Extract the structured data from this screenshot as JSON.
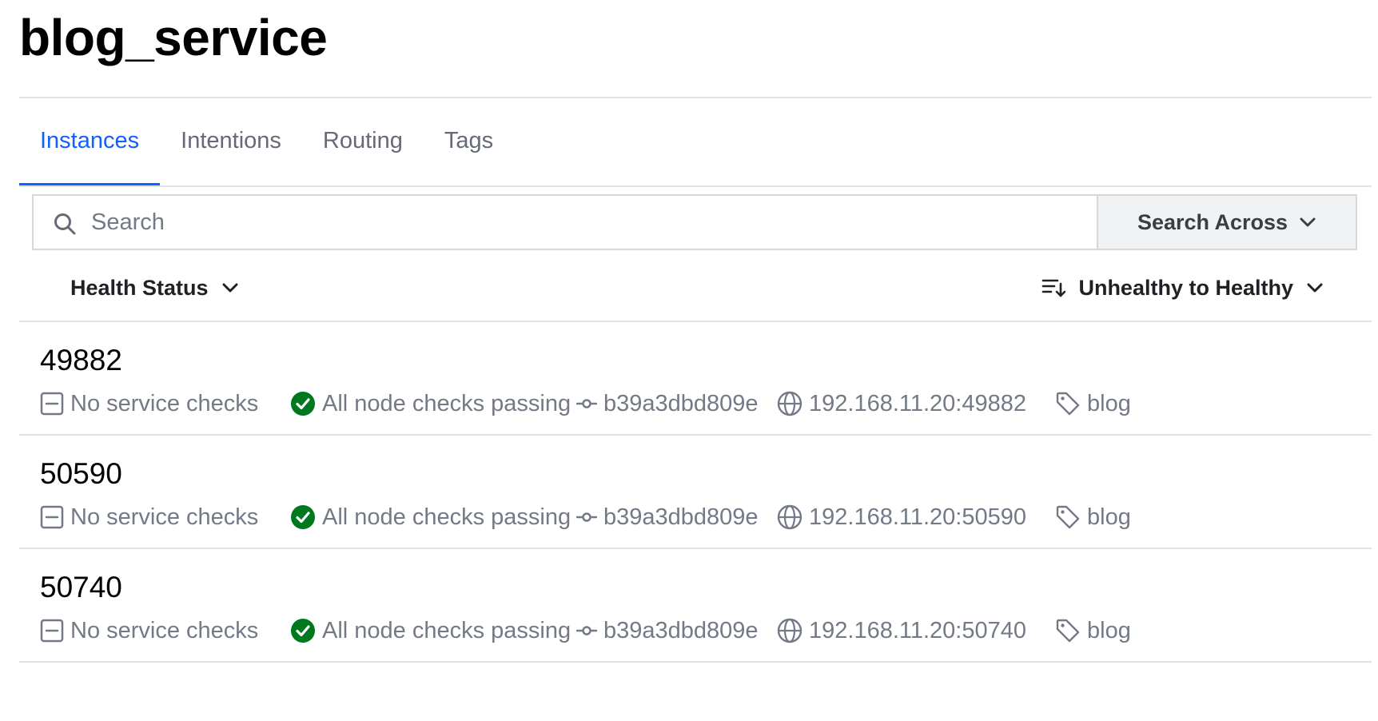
{
  "page": {
    "title": "blog_service"
  },
  "tabs": [
    {
      "label": "Instances",
      "active": true
    },
    {
      "label": "Intentions",
      "active": false
    },
    {
      "label": "Routing",
      "active": false
    },
    {
      "label": "Tags",
      "active": false
    }
  ],
  "search": {
    "placeholder": "Search",
    "value": "",
    "across_label": "Search Across",
    "icon": "search-icon"
  },
  "filters": {
    "health_status_label": "Health Status",
    "sort_label": "Unhealthy to Healthy",
    "sort_icon": "sort-icon"
  },
  "colors": {
    "accent": "#1060ff",
    "passing": "#00781e",
    "muted": "#737986"
  },
  "instances": [
    {
      "id": "49882",
      "service_checks": "No service checks",
      "node_checks": "All node checks passing",
      "node": "b39a3dbd809e",
      "address": "192.168.11.20:49882",
      "tag": "blog"
    },
    {
      "id": "50590",
      "service_checks": "No service checks",
      "node_checks": "All node checks passing",
      "node": "b39a3dbd809e",
      "address": "192.168.11.20:50590",
      "tag": "blog"
    },
    {
      "id": "50740",
      "service_checks": "No service checks",
      "node_checks": "All node checks passing",
      "node": "b39a3dbd809e",
      "address": "192.168.11.20:50740",
      "tag": "blog"
    }
  ]
}
